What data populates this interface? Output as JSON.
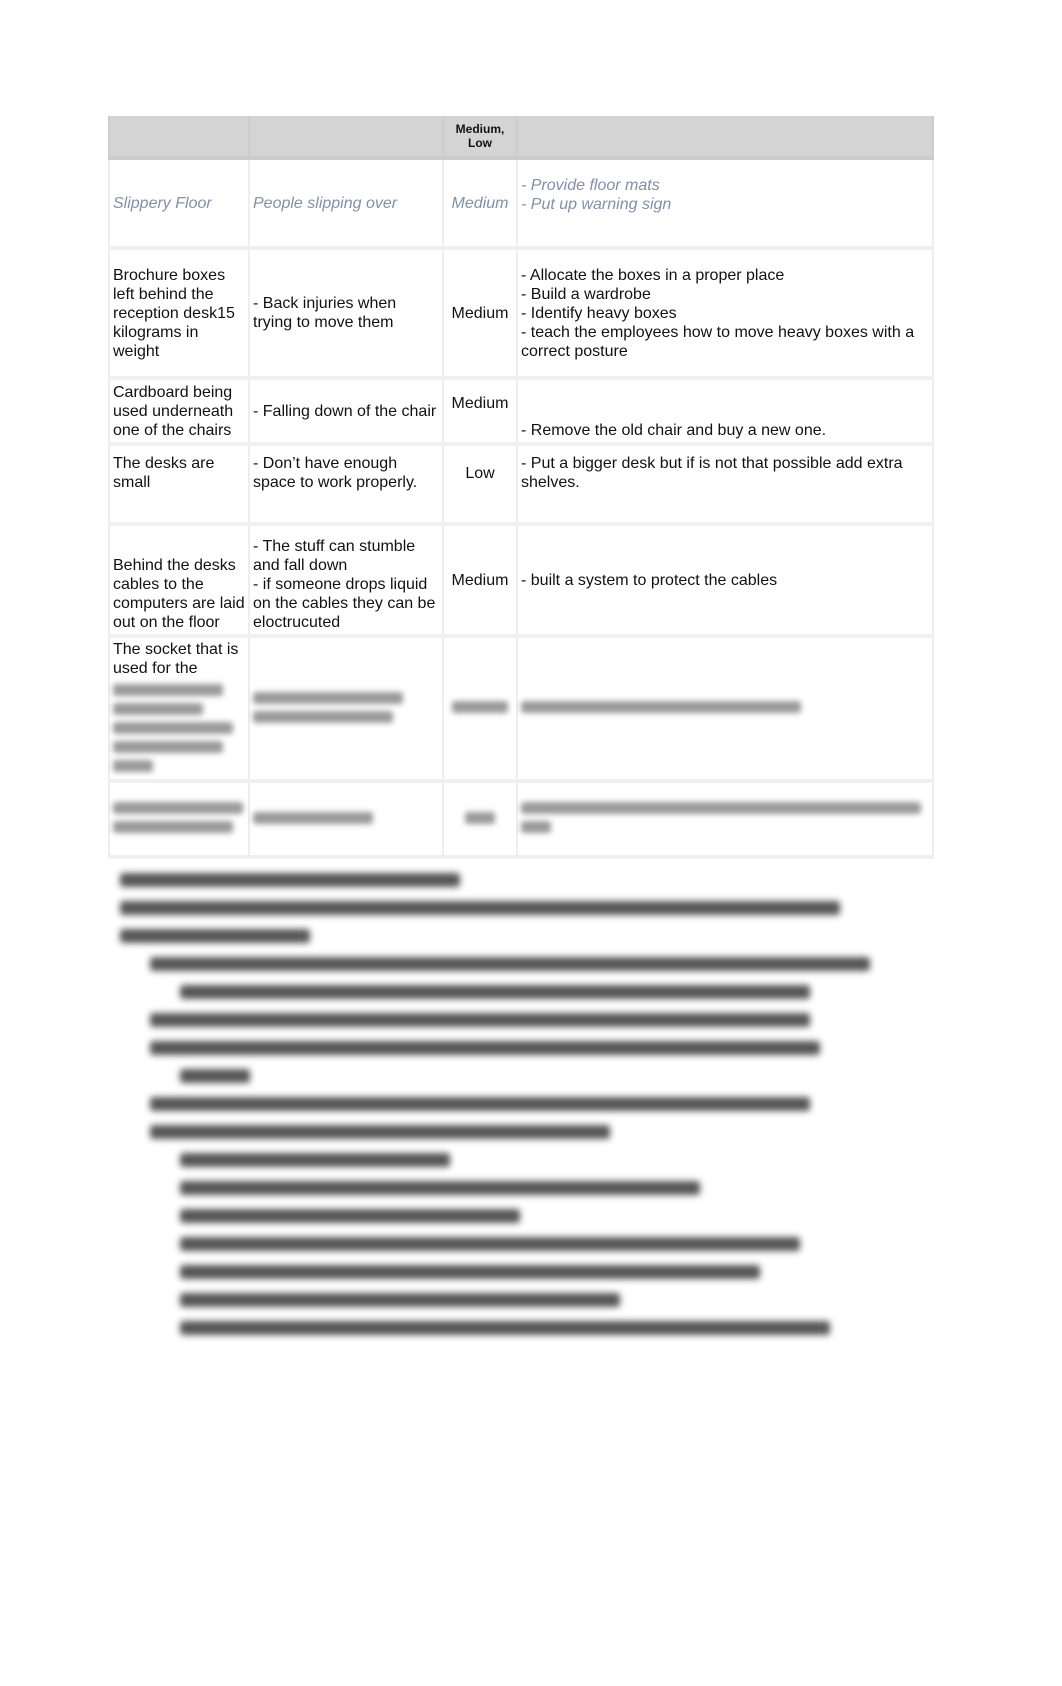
{
  "table": {
    "header_risk": "Medium, Low",
    "rows": [
      {
        "hazard": "Slippery Floor",
        "harm": "People slipping over",
        "risk": "Medium",
        "controls": [
          "- Provide floor mats",
          "- Put up warning sign"
        ]
      },
      {
        "hazard": "Brochure boxes left behind the reception desk15 kilograms in weight",
        "harm": "- Back injuries when trying to move them",
        "risk": "Medium",
        "controls": [
          "- Allocate the boxes in a proper place",
          "- Build a wardrobe",
          "- Identify heavy boxes",
          "- teach the employees how to move heavy boxes with a correct posture"
        ]
      },
      {
        "hazard": "Cardboard being used underneath one of the chairs",
        "harm": "- Falling down of the chair",
        "risk": "Medium",
        "controls": [
          "- Remove the old chair and buy a new one."
        ]
      },
      {
        "hazard": "The desks are small",
        "harm": "- Don’t have enough space to work properly.",
        "risk": "Low",
        "controls": [
          "- Put a bigger desk but if is not that possible add extra shelves."
        ]
      },
      {
        "hazard": "Behind the desks cables to the computers are laid out on the floor",
        "harm": "- The stuff can stumble and fall down",
        "harm2": "- if someone drops liquid on the cables they can be eloctrucuted",
        "risk": "Medium",
        "controls": [
          "- built a system to protect the cables"
        ]
      },
      {
        "hazard": "The socket that is used for the"
      }
    ]
  }
}
